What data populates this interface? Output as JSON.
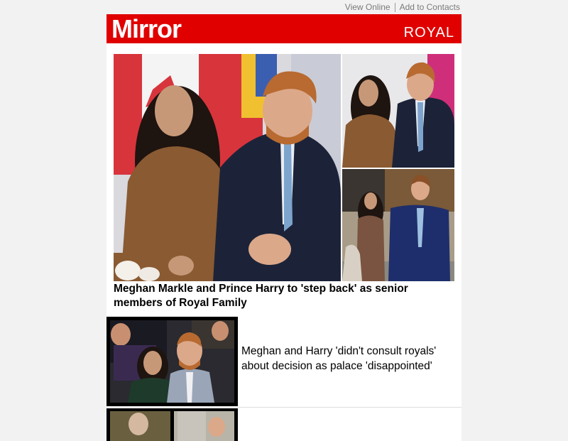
{
  "header": {
    "view_online": "View Online",
    "add_to_contacts": "Add to Contacts",
    "logo": "Mirror",
    "section": "ROYAL"
  },
  "lead": {
    "headline": "Meghan Markle and Prince Harry to 'step back' as senior members of Royal Family",
    "main_image": "Meghan and Harry seated in front of Canadian flag",
    "side_image_top": "Meghan and Harry standing portrait",
    "side_image_bottom": "Meghan and Harry walking outside"
  },
  "stories": [
    {
      "headline": "Meghan and Harry 'didn't consult royals' about decision as palace 'disappointed'",
      "image": "Meghan and Harry smiling at event"
    }
  ],
  "colors": {
    "brand_red": "#e00000",
    "background": "#f2f2f2"
  }
}
